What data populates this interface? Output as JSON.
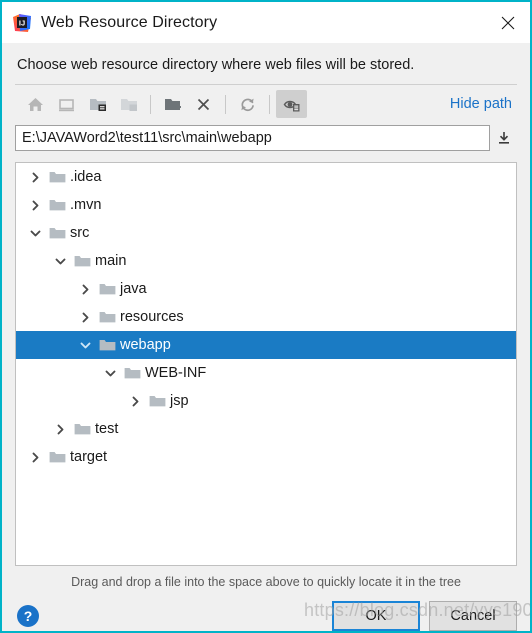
{
  "window": {
    "title": "Web Resource Directory",
    "app_icon": "intellij-idea-icon",
    "close_label": "✕",
    "border_color": "#00b3c8"
  },
  "header": {
    "subtitle": "Choose web resource directory where web files will be stored."
  },
  "toolbar": {
    "buttons": [
      {
        "name": "home-icon",
        "title": "Home",
        "state": "enabled"
      },
      {
        "name": "desktop-icon",
        "title": "Desktop",
        "state": "enabled"
      },
      {
        "name": "project-folder-icon",
        "title": "Project Directory",
        "state": "enabled"
      },
      {
        "name": "module-folder-icon",
        "title": "Module Directory",
        "state": "disabled"
      },
      {
        "name": "new-folder-icon",
        "title": "New Folder",
        "state": "enabled"
      },
      {
        "name": "delete-icon",
        "title": "Delete",
        "state": "enabled"
      },
      {
        "name": "refresh-icon",
        "title": "Refresh",
        "state": "enabled"
      },
      {
        "name": "show-hidden-files-icon",
        "title": "Show Hidden Files and Directories",
        "state": "pressed"
      }
    ],
    "hide_path_label": "Hide path"
  },
  "path": {
    "value": "E:\\JAVAWord2\\test11\\src\\main\\webapp",
    "placeholder": "",
    "expand_icon": "download-arrow-icon"
  },
  "tree": {
    "selection_color": "#1a7bc4",
    "nodes": [
      {
        "label": ".idea",
        "depth": 0,
        "expanded": false,
        "has_children": true,
        "selected": false
      },
      {
        "label": ".mvn",
        "depth": 0,
        "expanded": false,
        "has_children": true,
        "selected": false
      },
      {
        "label": "src",
        "depth": 0,
        "expanded": true,
        "has_children": true,
        "selected": false
      },
      {
        "label": "main",
        "depth": 1,
        "expanded": true,
        "has_children": true,
        "selected": false
      },
      {
        "label": "java",
        "depth": 2,
        "expanded": false,
        "has_children": true,
        "selected": false
      },
      {
        "label": "resources",
        "depth": 2,
        "expanded": false,
        "has_children": true,
        "selected": false
      },
      {
        "label": "webapp",
        "depth": 2,
        "expanded": true,
        "has_children": true,
        "selected": true
      },
      {
        "label": "WEB-INF",
        "depth": 3,
        "expanded": true,
        "has_children": true,
        "selected": false
      },
      {
        "label": "jsp",
        "depth": 4,
        "expanded": false,
        "has_children": true,
        "selected": false
      },
      {
        "label": "test",
        "depth": 1,
        "expanded": false,
        "has_children": true,
        "selected": false
      },
      {
        "label": "target",
        "depth": 0,
        "expanded": false,
        "has_children": true,
        "selected": false
      }
    ]
  },
  "footer": {
    "hint": "Drag and drop a file into the space above to quickly locate it in the tree",
    "help_label": "?",
    "ok_label": "OK",
    "cancel_label": "Cancel"
  },
  "watermark": {
    "text": "https://blog.csdn.net/yys190418"
  }
}
